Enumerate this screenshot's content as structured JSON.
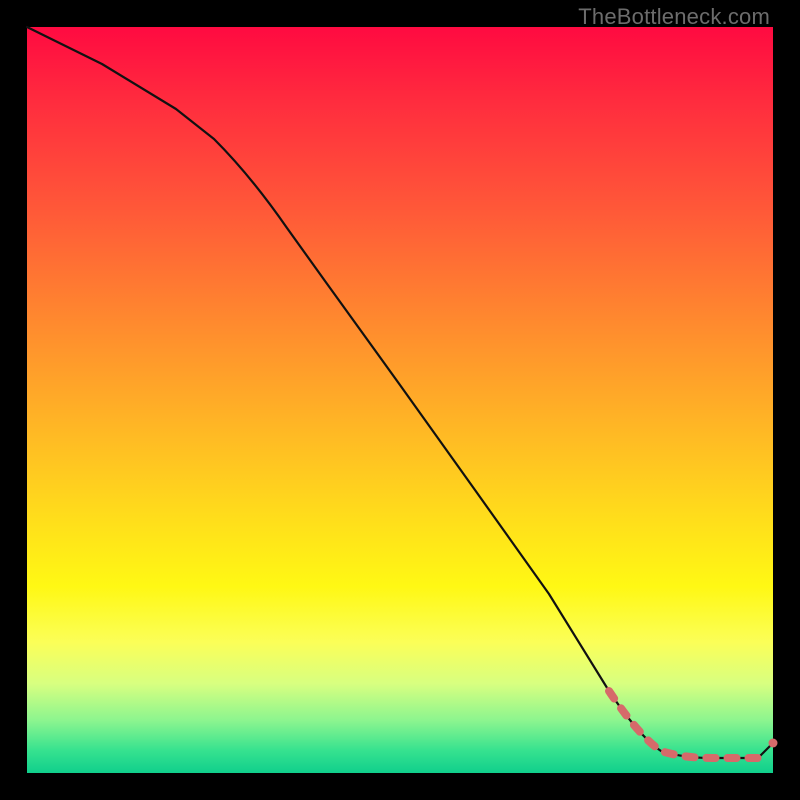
{
  "watermark": "TheBottleneck.com",
  "chart_data": {
    "type": "line",
    "title": "",
    "xlabel": "",
    "ylabel": "",
    "xlim": [
      0,
      100
    ],
    "ylim": [
      0,
      100
    ],
    "series": [
      {
        "name": "bottleneck-curve",
        "x": [
          0,
          10,
          20,
          25,
          30,
          40,
          50,
          60,
          70,
          78,
          82,
          85,
          88,
          92,
          95,
          98,
          100
        ],
        "y": [
          100,
          95,
          89,
          85,
          80,
          66,
          52,
          38,
          24,
          11,
          5,
          3,
          2,
          2,
          2,
          2,
          4
        ]
      }
    ],
    "highlight": {
      "name": "optimal-range-dots",
      "x": [
        78,
        80,
        82,
        84,
        86,
        88,
        90,
        92,
        94,
        96,
        98,
        100
      ],
      "y": [
        11,
        8,
        5,
        4,
        3,
        2,
        2,
        2,
        2,
        2,
        2,
        4
      ]
    }
  }
}
